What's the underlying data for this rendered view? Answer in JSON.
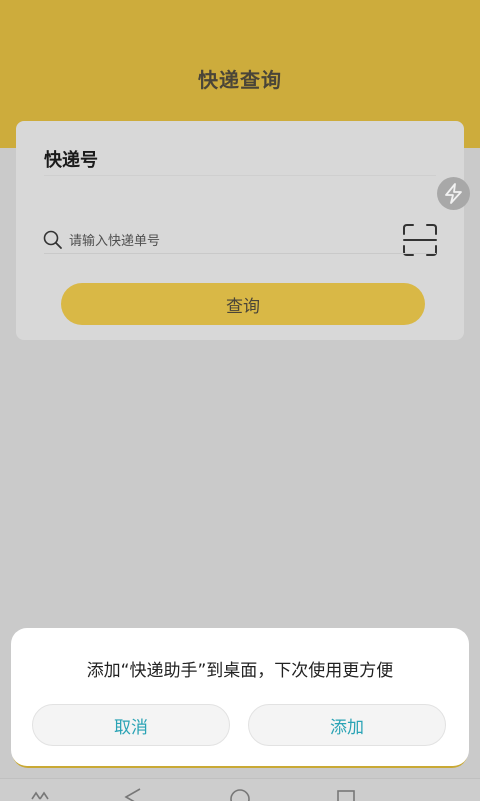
{
  "header": {
    "title": "快递查询"
  },
  "card": {
    "label": "快递号",
    "search_placeholder": "请输入快递单号",
    "query_button": "查询"
  },
  "dialog": {
    "message": "添加“快递助手”到桌面，下次使用更方便",
    "cancel_label": "取消",
    "add_label": "添加"
  },
  "colors": {
    "accent": "#cdac3c",
    "button": "#d9b846",
    "dialog_button_text": "#2aa3b5"
  },
  "icons": [
    "search-icon",
    "scan-icon",
    "floating-flash-icon",
    "nav-menu-icon",
    "nav-back-icon",
    "nav-home-icon",
    "nav-recent-icon"
  ]
}
